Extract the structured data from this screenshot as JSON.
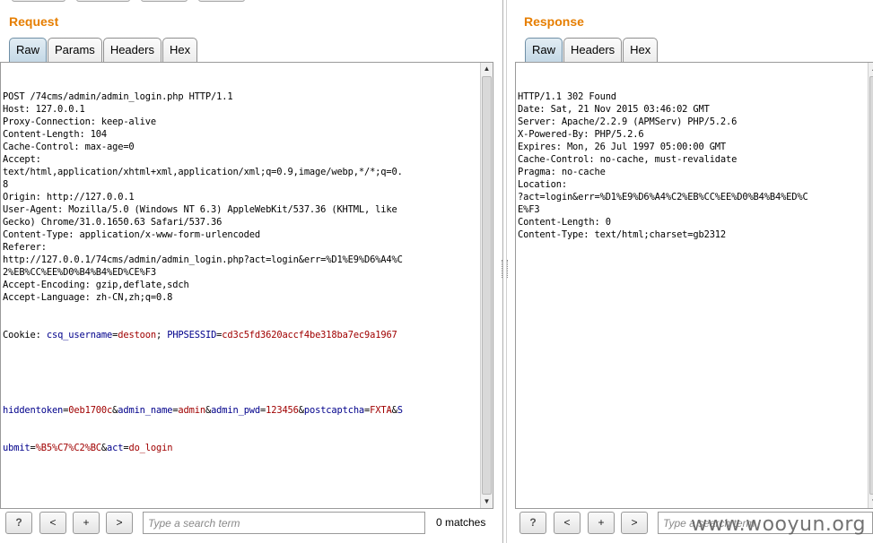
{
  "request": {
    "title": "Request",
    "tabs": [
      {
        "label": "Raw",
        "active": true
      },
      {
        "label": "Params",
        "active": false
      },
      {
        "label": "Headers",
        "active": false
      },
      {
        "label": "Hex",
        "active": false
      }
    ],
    "lines": [
      "POST /74cms/admin/admin_login.php HTTP/1.1",
      "Host: 127.0.0.1",
      "Proxy-Connection: keep-alive",
      "Content-Length: 104",
      "Cache-Control: max-age=0",
      "Accept:",
      "text/html,application/xhtml+xml,application/xml;q=0.9,image/webp,*/*;q=0.",
      "8",
      "Origin: http://127.0.0.1",
      "User-Agent: Mozilla/5.0 (Windows NT 6.3) AppleWebKit/537.36 (KHTML, like",
      "Gecko) Chrome/31.0.1650.63 Safari/537.36",
      "Content-Type: application/x-www-form-urlencoded",
      "Referer:",
      "http://127.0.0.1/74cms/admin/admin_login.php?act=login&err=%D1%E9%D6%A4%C",
      "2%EB%CC%EE%D0%B4%B4%ED%CE%F3",
      "Accept-Encoding: gzip,deflate,sdch",
      "Accept-Language: zh-CN,zh;q=0.8"
    ],
    "cookie": {
      "prefix": "Cookie: ",
      "name1": "csq_username",
      "value1": "destoon",
      "sep": "; ",
      "name2": "PHPSESSID",
      "value2": "cd3c5fd3620accf4be318ba7ec9a1967"
    },
    "body_line1": [
      {
        "t": "hiddentoken",
        "c": "n"
      },
      {
        "t": "=",
        "c": "p"
      },
      {
        "t": "0eb1700c",
        "c": "v"
      },
      {
        "t": "&",
        "c": "p"
      },
      {
        "t": "admin_name",
        "c": "n"
      },
      {
        "t": "=",
        "c": "p"
      },
      {
        "t": "admin",
        "c": "v"
      },
      {
        "t": "&",
        "c": "p"
      },
      {
        "t": "admin_pwd",
        "c": "n"
      },
      {
        "t": "=",
        "c": "p"
      },
      {
        "t": "123456",
        "c": "v"
      },
      {
        "t": "&",
        "c": "p"
      },
      {
        "t": "postcaptcha",
        "c": "n"
      },
      {
        "t": "=",
        "c": "p"
      },
      {
        "t": "FXTA",
        "c": "v"
      },
      {
        "t": "&",
        "c": "p"
      },
      {
        "t": "S",
        "c": "n"
      }
    ],
    "body_line2": [
      {
        "t": "ubmit",
        "c": "n"
      },
      {
        "t": "=",
        "c": "p"
      },
      {
        "t": "%B5%C7%C2%BC",
        "c": "v"
      },
      {
        "t": "&",
        "c": "p"
      },
      {
        "t": "act",
        "c": "n"
      },
      {
        "t": "=",
        "c": "p"
      },
      {
        "t": "do_login",
        "c": "v"
      }
    ],
    "search_placeholder": "Type a search term",
    "matches": "0 matches"
  },
  "response": {
    "title": "Response",
    "tabs": [
      {
        "label": "Raw",
        "active": true
      },
      {
        "label": "Headers",
        "active": false
      },
      {
        "label": "Hex",
        "active": false
      }
    ],
    "lines": [
      "HTTP/1.1 302 Found",
      "Date: Sat, 21 Nov 2015 03:46:02 GMT",
      "Server: Apache/2.2.9 (APMServ) PHP/5.2.6",
      "X-Powered-By: PHP/5.2.6",
      "Expires: Mon, 26 Jul 1997 05:00:00 GMT",
      "Cache-Control: no-cache, must-revalidate",
      "Pragma: no-cache",
      "Location:",
      "?act=login&err=%D1%E9%D6%A4%C2%EB%CC%EE%D0%B4%B4%ED%C",
      "E%F3",
      "Content-Length: 0",
      "Content-Type: text/html;charset=gb2312"
    ],
    "search_placeholder": "Type a search term"
  },
  "buttons": {
    "help": "?",
    "prev": "<",
    "add": "+",
    "next": ">"
  },
  "icons": {
    "scroll_up": "triangle-up-icon",
    "scroll_down": "triangle-down-icon"
  },
  "colors": {
    "title": "#e67e00",
    "param_name": "#00008b",
    "param_value": "#a00000"
  },
  "watermark": "www.wooyun.org"
}
